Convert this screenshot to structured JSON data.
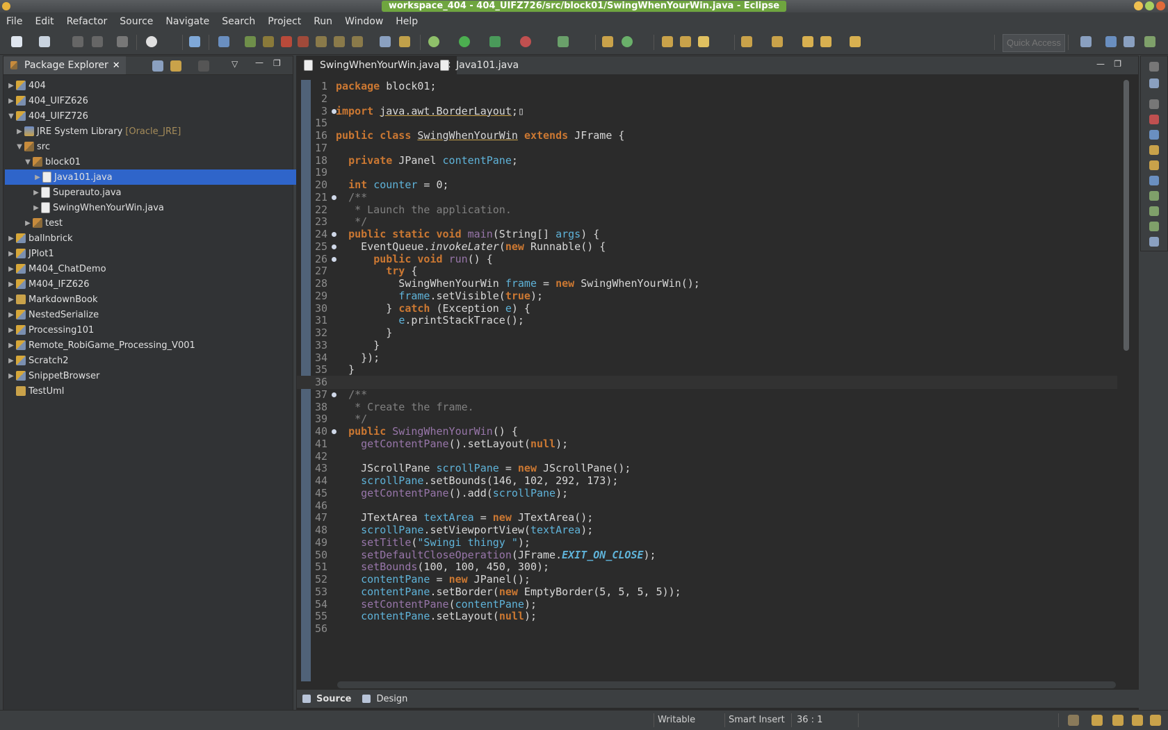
{
  "window": {
    "title": "workspace_404 - 404_UIFZ726/src/block01/SwingWhenYourWin.java - Eclipse"
  },
  "menu": [
    "File",
    "Edit",
    "Refactor",
    "Source",
    "Navigate",
    "Search",
    "Project",
    "Run",
    "Window",
    "Help"
  ],
  "toolbar": {
    "quick_access_placeholder": "Quick Access"
  },
  "package_explorer": {
    "tab_label": "Package Explorer",
    "items": [
      {
        "label": "404",
        "icon": "project-icon",
        "expanded": false
      },
      {
        "label": "404_UIFZ626",
        "icon": "project-icon",
        "expanded": false
      },
      {
        "label": "404_UIFZ726",
        "icon": "project-icon",
        "expanded": true
      },
      {
        "label": "JRE System Library",
        "suffix": "[Oracle_JRE]",
        "icon": "library-icon",
        "expanded": false
      },
      {
        "label": "src",
        "icon": "source-folder-icon",
        "expanded": true
      },
      {
        "label": "block01",
        "icon": "package-icon",
        "expanded": true
      },
      {
        "label": "Java101.java",
        "icon": "java-file-icon",
        "expanded": false,
        "selected": true
      },
      {
        "label": "Superauto.java",
        "icon": "java-file-icon",
        "expanded": false
      },
      {
        "label": "SwingWhenYourWin.java",
        "icon": "java-file-icon",
        "expanded": false
      },
      {
        "label": "test",
        "icon": "package-icon",
        "expanded": false
      },
      {
        "label": "ballnbrick",
        "icon": "project-icon",
        "expanded": false
      },
      {
        "label": "JPlot1",
        "icon": "project-icon",
        "expanded": false
      },
      {
        "label": "M404_ChatDemo",
        "icon": "project-icon",
        "expanded": false
      },
      {
        "label": "M404_IFZ626",
        "icon": "project-icon",
        "expanded": false
      },
      {
        "label": "MarkdownBook",
        "icon": "folder-icon",
        "expanded": false
      },
      {
        "label": "NestedSerialize",
        "icon": "project-icon",
        "expanded": false
      },
      {
        "label": "Processing101",
        "icon": "project-icon",
        "expanded": false
      },
      {
        "label": "Remote_RobiGame_Processing_V001",
        "icon": "project-icon",
        "expanded": false
      },
      {
        "label": "Scratch2",
        "icon": "project-icon",
        "expanded": false
      },
      {
        "label": "SnippetBrowser",
        "icon": "project-icon",
        "expanded": false
      },
      {
        "label": "TestUml",
        "icon": "folder-icon",
        "expanded": null
      }
    ]
  },
  "editor": {
    "tabs": [
      {
        "label": "SwingWhenYourWin.java",
        "active": true
      },
      {
        "label": "Java101.java",
        "active": false
      }
    ],
    "lines": [
      {
        "n": "1",
        "html": "<span class=\"k\">package</span> block01;"
      },
      {
        "n": "2",
        "html": ""
      },
      {
        "n": "3",
        "html": "<span class=\"k\">import</span> <span class=\"u\">java.awt.BorderLayout</span>;▯",
        "fold": true
      },
      {
        "n": "15",
        "html": ""
      },
      {
        "n": "16",
        "html": "<span class=\"k\">public class</span> <span class=\"u\">SwingWhenYourWin</span> <span class=\"k\">extends</span> JFrame {"
      },
      {
        "n": "17",
        "html": ""
      },
      {
        "n": "18",
        "html": "  <span class=\"k\">private</span> JPanel <span class=\"v\">contentPane</span>;"
      },
      {
        "n": "19",
        "html": ""
      },
      {
        "n": "20",
        "html": "  <span class=\"k\">int</span> <span class=\"v\">counter</span> = 0;"
      },
      {
        "n": "21",
        "html": "  <span class=\"c\">/**</span>",
        "fold": true
      },
      {
        "n": "22",
        "html": "<span class=\"c\">   * Launch the application.</span>"
      },
      {
        "n": "23",
        "html": "<span class=\"c\">   */</span>"
      },
      {
        "n": "24",
        "html": "  <span class=\"k\">public static void</span> <span class=\"f\">main</span>(String[] <span class=\"v\">args</span>) {",
        "fold": true
      },
      {
        "n": "25",
        "html": "    EventQueue.<span class=\"it\">invokeLater</span>(<span class=\"k\">new</span> Runnable() {",
        "fold": true
      },
      {
        "n": "26",
        "html": "      <span class=\"k\">public void</span> <span class=\"f\">run</span>() {",
        "fold": true
      },
      {
        "n": "27",
        "html": "        <span class=\"k\">try</span> {"
      },
      {
        "n": "28",
        "html": "          SwingWhenYourWin <span class=\"v\">frame</span> = <span class=\"k\">new</span> SwingWhenYourWin();"
      },
      {
        "n": "29",
        "html": "          <span class=\"v\">frame</span>.setVisible(<span class=\"k\">true</span>);"
      },
      {
        "n": "30",
        "html": "        } <span class=\"k\">catch</span> (Exception <span class=\"v\">e</span>) {"
      },
      {
        "n": "31",
        "html": "          <span class=\"v\">e</span>.printStackTrace();"
      },
      {
        "n": "32",
        "html": "        }"
      },
      {
        "n": "33",
        "html": "      }"
      },
      {
        "n": "34",
        "html": "    });"
      },
      {
        "n": "35",
        "html": "  }"
      },
      {
        "n": "36",
        "html": "",
        "current": true
      },
      {
        "n": "37",
        "html": "  <span class=\"c\">/**</span>",
        "fold": true
      },
      {
        "n": "38",
        "html": "<span class=\"c\">   * Create the frame.</span>"
      },
      {
        "n": "39",
        "html": "<span class=\"c\">   */</span>"
      },
      {
        "n": "40",
        "html": "  <span class=\"k\">public</span> <span class=\"f\">SwingWhenYourWin</span>() {",
        "fold": true
      },
      {
        "n": "41",
        "html": "    <span class=\"f\">getContentPane</span>().setLayout(<span class=\"k\">null</span>);"
      },
      {
        "n": "42",
        "html": ""
      },
      {
        "n": "43",
        "html": "    JScrollPane <span class=\"v\">scrollPane</span> = <span class=\"k\">new</span> JScrollPane();"
      },
      {
        "n": "44",
        "html": "    <span class=\"v\">scrollPane</span>.setBounds(146, 102, 292, 173);"
      },
      {
        "n": "45",
        "html": "    <span class=\"f\">getContentPane</span>().add(<span class=\"v\">scrollPane</span>);"
      },
      {
        "n": "46",
        "html": ""
      },
      {
        "n": "47",
        "html": "    JTextArea <span class=\"v\">textArea</span> = <span class=\"k\">new</span> JTextArea();"
      },
      {
        "n": "48",
        "html": "    <span class=\"v\">scrollPane</span>.setViewportView(<span class=\"v\">textArea</span>);"
      },
      {
        "n": "49",
        "html": "    <span class=\"f\">setTitle</span>(<span class=\"v\">\"Swingi thingy \"</span>);"
      },
      {
        "n": "50",
        "html": "    <span class=\"f\">setDefaultCloseOperation</span>(JFrame.<span class=\"v it\"><b>EXIT_ON_CLOSE</b></span>);"
      },
      {
        "n": "51",
        "html": "    <span class=\"f\">setBounds</span>(100, 100, 450, 300);"
      },
      {
        "n": "52",
        "html": "    <span class=\"v\">contentPane</span> = <span class=\"k\">new</span> JPanel();"
      },
      {
        "n": "53",
        "html": "    <span class=\"v\">contentPane</span>.setBorder(<span class=\"k\">new</span> EmptyBorder(5, 5, 5, 5));"
      },
      {
        "n": "54",
        "html": "    <span class=\"f\">setContentPane</span>(<span class=\"v\">contentPane</span>);"
      },
      {
        "n": "55",
        "html": "    <span class=\"v\">contentPane</span>.setLayout(<span class=\"k\">null</span>);"
      },
      {
        "n": "56",
        "html": ""
      }
    ],
    "bottom_tabs": [
      {
        "label": "Source",
        "active": true
      },
      {
        "label": "Design",
        "active": false
      }
    ]
  },
  "status": {
    "mode": "Writable",
    "insert": "Smart Insert",
    "position": "36 : 1"
  },
  "colors": {
    "selection": "#2f65ca",
    "title_bg": "#6fa53f",
    "keyword": "#cc7832"
  }
}
